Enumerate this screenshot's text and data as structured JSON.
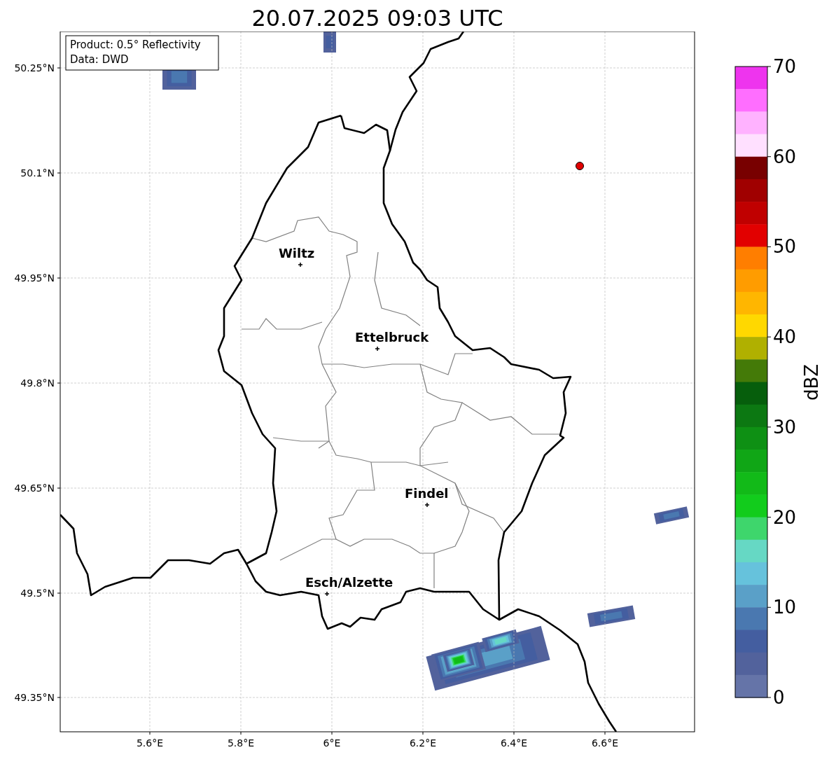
{
  "title": "20.07.2025 09:03 UTC",
  "info_box": [
    "Product: 0.5° Reflectivity",
    "Data: DWD"
  ],
  "lat_ticks": [
    "50.25°N",
    "50.1°N",
    "49.95°N",
    "49.8°N",
    "49.65°N",
    "49.5°N",
    "49.35°N"
  ],
  "lon_ticks": [
    "5.6°E",
    "5.8°E",
    "6°E",
    "6.2°E",
    "6.4°E",
    "6.6°E"
  ],
  "cities": [
    {
      "name": "Wiltz"
    },
    {
      "name": "Ettelbruck"
    },
    {
      "name": "Findel"
    },
    {
      "name": "Esch/Alzette"
    }
  ],
  "colorbar": {
    "label": "dBZ",
    "ticks": [
      "70",
      "60",
      "50",
      "40",
      "30",
      "20",
      "10",
      "0"
    ],
    "bins": [
      {
        "color": "#ee34ee"
      },
      {
        "color": "#ff6eff"
      },
      {
        "color": "#ffb2ff"
      },
      {
        "color": "#ffe0ff"
      },
      {
        "color": "#780000"
      },
      {
        "color": "#a00000"
      },
      {
        "color": "#c00000"
      },
      {
        "color": "#e20000"
      },
      {
        "color": "#ff7e00"
      },
      {
        "color": "#ff9c00"
      },
      {
        "color": "#ffb600"
      },
      {
        "color": "#ffd800"
      },
      {
        "color": "#b0b000"
      },
      {
        "color": "#447a08"
      },
      {
        "color": "#065e0c"
      },
      {
        "color": "#0c7812"
      },
      {
        "color": "#0e9014"
      },
      {
        "color": "#10a616"
      },
      {
        "color": "#12ba18"
      },
      {
        "color": "#12cc1c"
      },
      {
        "color": "#3ed66c"
      },
      {
        "color": "#66d8c4"
      },
      {
        "color": "#66c2dc"
      },
      {
        "color": "#5aa0c8"
      },
      {
        "color": "#4a78b0"
      },
      {
        "color": "#445ea0"
      },
      {
        "color": "#52629c"
      },
      {
        "color": "#6574a8"
      }
    ]
  }
}
